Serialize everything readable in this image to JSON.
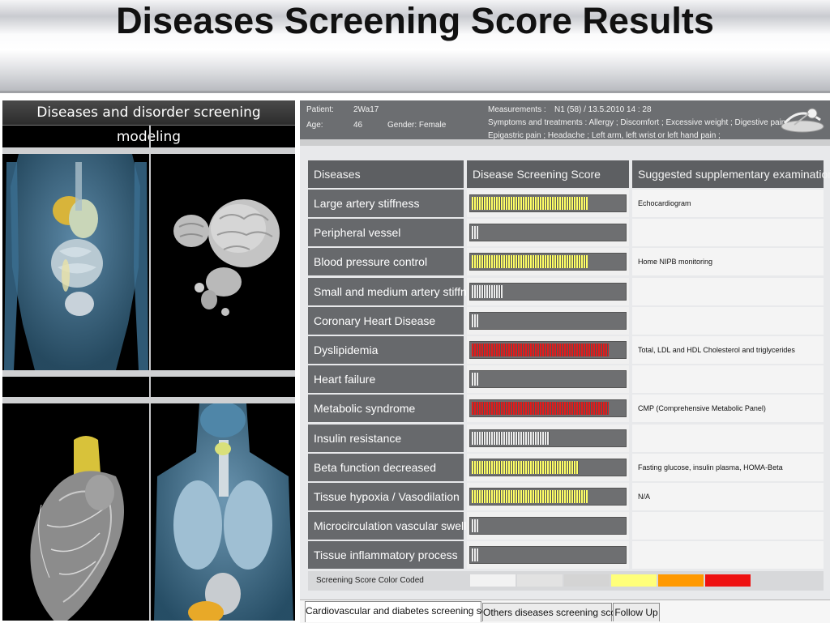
{
  "slide": {
    "title": "Diseases Screening Score Results"
  },
  "left_panel": {
    "title": "Diseases and disorder screening modeling"
  },
  "patient": {
    "patient_label": "Patient:",
    "patient_value": "2Wa17",
    "age_label": "Age:",
    "age_value": "46",
    "gender_text": "Gender:  Female",
    "measurements_label": "Measurements :",
    "measurements_value": "N1 (58)  / 13.5.2010  14 : 28",
    "symptoms_line1": "Symptoms and treatments : Allergy ; Discomfort ; Excessive weight ; Digestive pain ;",
    "symptoms_line2": "Epigastric pain ; Headache ; Left arm, left wrist or left hand pain ;"
  },
  "table": {
    "headers": {
      "disease": "Diseases",
      "score": "Disease Screening Score",
      "exam": "Suggested supplementary examinations"
    },
    "rows": [
      {
        "disease": "Large artery stiffness",
        "score": 0.76,
        "level": "yellow",
        "exam": "Echocardiogram"
      },
      {
        "disease": "Peripheral vessel",
        "score": 0.04,
        "level": "white",
        "exam": ""
      },
      {
        "disease": "Blood pressure control",
        "score": 0.76,
        "level": "yellow",
        "exam": "Home NIPB monitoring"
      },
      {
        "disease": "Small and medium artery stiffness",
        "score": 0.2,
        "level": "white",
        "exam": ""
      },
      {
        "disease": "Coronary Heart Disease",
        "score": 0.04,
        "level": "white",
        "exam": ""
      },
      {
        "disease": "Dyslipidemia",
        "score": 0.9,
        "level": "red",
        "exam": "Total, LDL and HDL Cholesterol and triglycerides"
      },
      {
        "disease": "Heart failure",
        "score": 0.04,
        "level": "white",
        "exam": ""
      },
      {
        "disease": "Metabolic syndrome",
        "score": 0.9,
        "level": "red",
        "exam": "CMP (Comprehensive Metabolic Panel)"
      },
      {
        "disease": "Insulin resistance",
        "score": 0.51,
        "level": "white",
        "exam": ""
      },
      {
        "disease": "Beta function decreased",
        "score": 0.7,
        "level": "yellow",
        "exam": "Fasting glucose, insulin plasma, HOMA-Beta"
      },
      {
        "disease": "Tissue hypoxia / Vasodilation",
        "score": 0.76,
        "level": "yellow",
        "exam": "N/A"
      },
      {
        "disease": "Microcirculation vascular swelling",
        "score": 0.04,
        "level": "white",
        "exam": ""
      },
      {
        "disease": "Tissue inflammatory process",
        "score": 0.04,
        "level": "white",
        "exam": ""
      }
    ]
  },
  "legend": {
    "label": "Screening Score Color Coded",
    "colors": [
      "#f2f2f2",
      "#e2e2e2",
      "#d4d4d4",
      "#ffff7a",
      "#ff9900",
      "#ee1111"
    ]
  },
  "level_colors": {
    "white": "#ececec",
    "yellow": "#ffff66",
    "red": "#e41b1b"
  },
  "tabs": [
    {
      "label": "Cardiovascular and diabetes screening score",
      "active": true
    },
    {
      "label": "Others diseases screening score",
      "active": false
    },
    {
      "label": "Follow Up",
      "active": false
    }
  ]
}
